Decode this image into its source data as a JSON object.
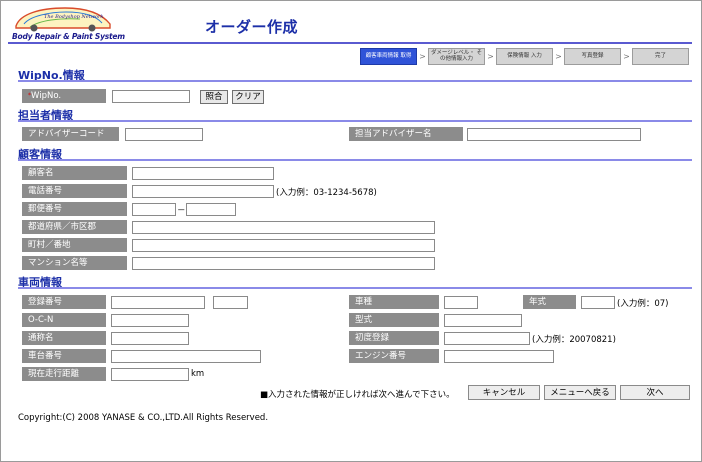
{
  "header": {
    "logo_network": "The Bodyshop Network",
    "logo_subtitle": "Body Repair & Paint System",
    "title": "オーダー作成"
  },
  "steps": [
    {
      "label": "顧客車両情報 取得",
      "active": true
    },
    {
      "label": "ダメージレベル・ その他情報入力",
      "active": false
    },
    {
      "label": "保険情報 入力",
      "active": false
    },
    {
      "label": "写真登録",
      "active": false
    },
    {
      "label": "完了",
      "active": false
    }
  ],
  "wip": {
    "section_title": "WipNo.情報",
    "required_mark": "*",
    "label": "WipNo.",
    "value": "",
    "lookup_button": "照合",
    "clear_button": "クリア"
  },
  "staff": {
    "section_title": "担当者情報",
    "advisor_code_label": "アドバイザーコード",
    "advisor_code_value": "",
    "advisor_name_label": "担当アドバイザー名",
    "advisor_name_value": ""
  },
  "customer": {
    "section_title": "顧客情報",
    "name_label": "顧客名",
    "phone_label": "電話番号",
    "phone_hint": "(入力例：03-1234-5678)",
    "postal_label": "郵便番号",
    "postal_separator": "－",
    "prefecture_label": "都道府県／市区郡",
    "town_label": "町村／番地",
    "building_label": "マンション名等"
  },
  "vehicle": {
    "section_title": "車両情報",
    "reg_no_label": "登録番号",
    "ocn_label": "O-C-N",
    "common_name_label": "通称名",
    "chassis_label": "車台番号",
    "mileage_label": "現在走行距離",
    "mileage_unit": "km",
    "model_label": "車種",
    "year_label": "年式",
    "year_hint": "(入力例：07)",
    "type_label": "型式",
    "first_reg_label": "初度登録",
    "first_reg_hint": "(入力例：20070821)",
    "engine_label": "エンジン番号"
  },
  "footer": {
    "instruction": "■入力された情報が正しければ次へ進んで下さい。",
    "cancel_button": "キャンセル",
    "menu_button": "メニューへ戻る",
    "next_button": "次へ",
    "copyright": "Copyright:(C) 2008 YANASE & CO.,LTD.All Rights Reserved."
  },
  "colors": {
    "title": "#1c2fa8",
    "section_rule": "#8a8ae8",
    "label_bg": "#8c8c8c",
    "active_step": "#2f53d8"
  }
}
